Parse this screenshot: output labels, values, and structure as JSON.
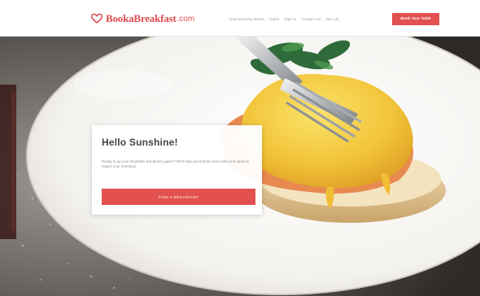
{
  "header": {
    "logo_name": "BookaBreakfast",
    "logo_tld": ".com",
    "nav": [
      "How Booking Works",
      "Cafés",
      "Sign In",
      "Contact Us",
      "Join Us"
    ],
    "cta_label": "Book Your Table"
  },
  "hero_card": {
    "title": "Hello Sunshine!",
    "description": "Ready to up your breakfast and brunch game? We'll help you find the best cafes and spots to inspire your mornings.",
    "button_label": "FIND A BREAKFAST"
  },
  "colors": {
    "brand": "#e04b4f",
    "button": "#e2504f"
  }
}
